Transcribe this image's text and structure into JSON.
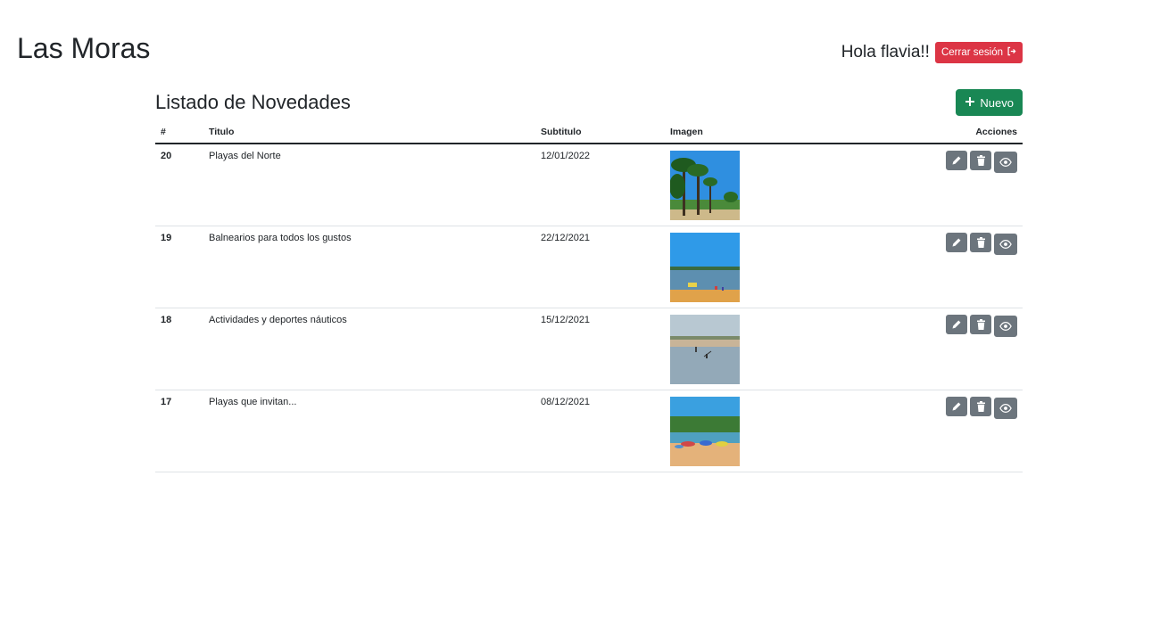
{
  "brand": "Las Moras",
  "header": {
    "greeting": "Hola flavia!!",
    "logout_label": "Cerrar sesión"
  },
  "page": {
    "title": "Listado de Novedades",
    "new_button_label": "Nuevo"
  },
  "table": {
    "headers": {
      "num": "#",
      "title": "Titulo",
      "subtitle": "Subtitulo",
      "image": "Imagen",
      "actions": "Acciones"
    },
    "rows": [
      {
        "id": "20",
        "title": "Playas del Norte",
        "subtitle": "12/01/2022",
        "image": "palm-beach"
      },
      {
        "id": "19",
        "title": "Balnearios para todos los gustos",
        "subtitle": "22/12/2021",
        "image": "river-beach"
      },
      {
        "id": "18",
        "title": "Actividades y deportes náuticos",
        "subtitle": "15/12/2021",
        "image": "water-sports"
      },
      {
        "id": "17",
        "title": "Playas que invitan...",
        "subtitle": "08/12/2021",
        "image": "crowded-beach"
      }
    ]
  },
  "icons": {
    "logout": "logout-icon",
    "add": "plus-icon",
    "edit": "pencil-icon",
    "delete": "trash-icon",
    "view": "eye-icon"
  },
  "colors": {
    "danger": "#dc3545",
    "success": "#198754",
    "secondary": "#6c757d"
  }
}
